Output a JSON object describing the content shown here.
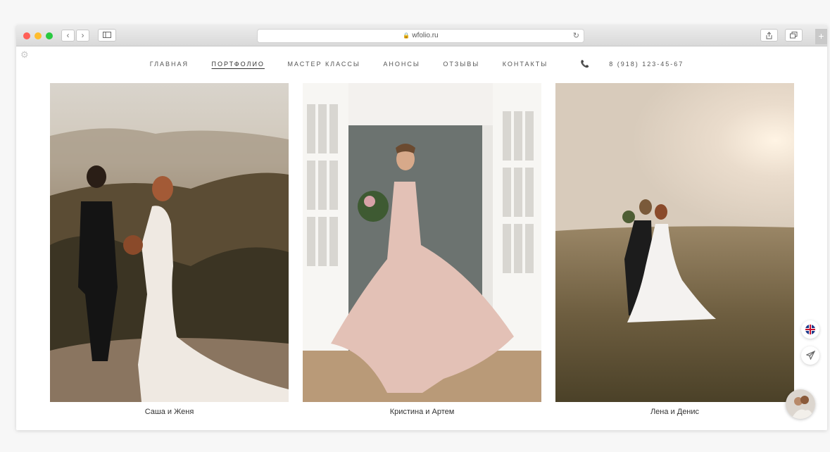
{
  "browser": {
    "url": "wfolio.ru",
    "back_icon": "chevron-left-icon",
    "forward_icon": "chevron-right-icon"
  },
  "nav": {
    "items": [
      "ГЛАВНАЯ",
      "ПОРТФОЛИО",
      "МАСТЕР КЛАССЫ",
      "АНОНСЫ",
      "ОТЗЫВЫ",
      "КОНТАКТЫ"
    ],
    "active": "ПОРТФОЛИО",
    "phone": "8 (918) 123-45-67"
  },
  "gallery": [
    {
      "caption": "Саша и Женя"
    },
    {
      "caption": "Кристина и Артем"
    },
    {
      "caption": "Лена и Денис"
    }
  ],
  "colors": {
    "accent_phone": "#aa3333",
    "text": "#555555"
  }
}
